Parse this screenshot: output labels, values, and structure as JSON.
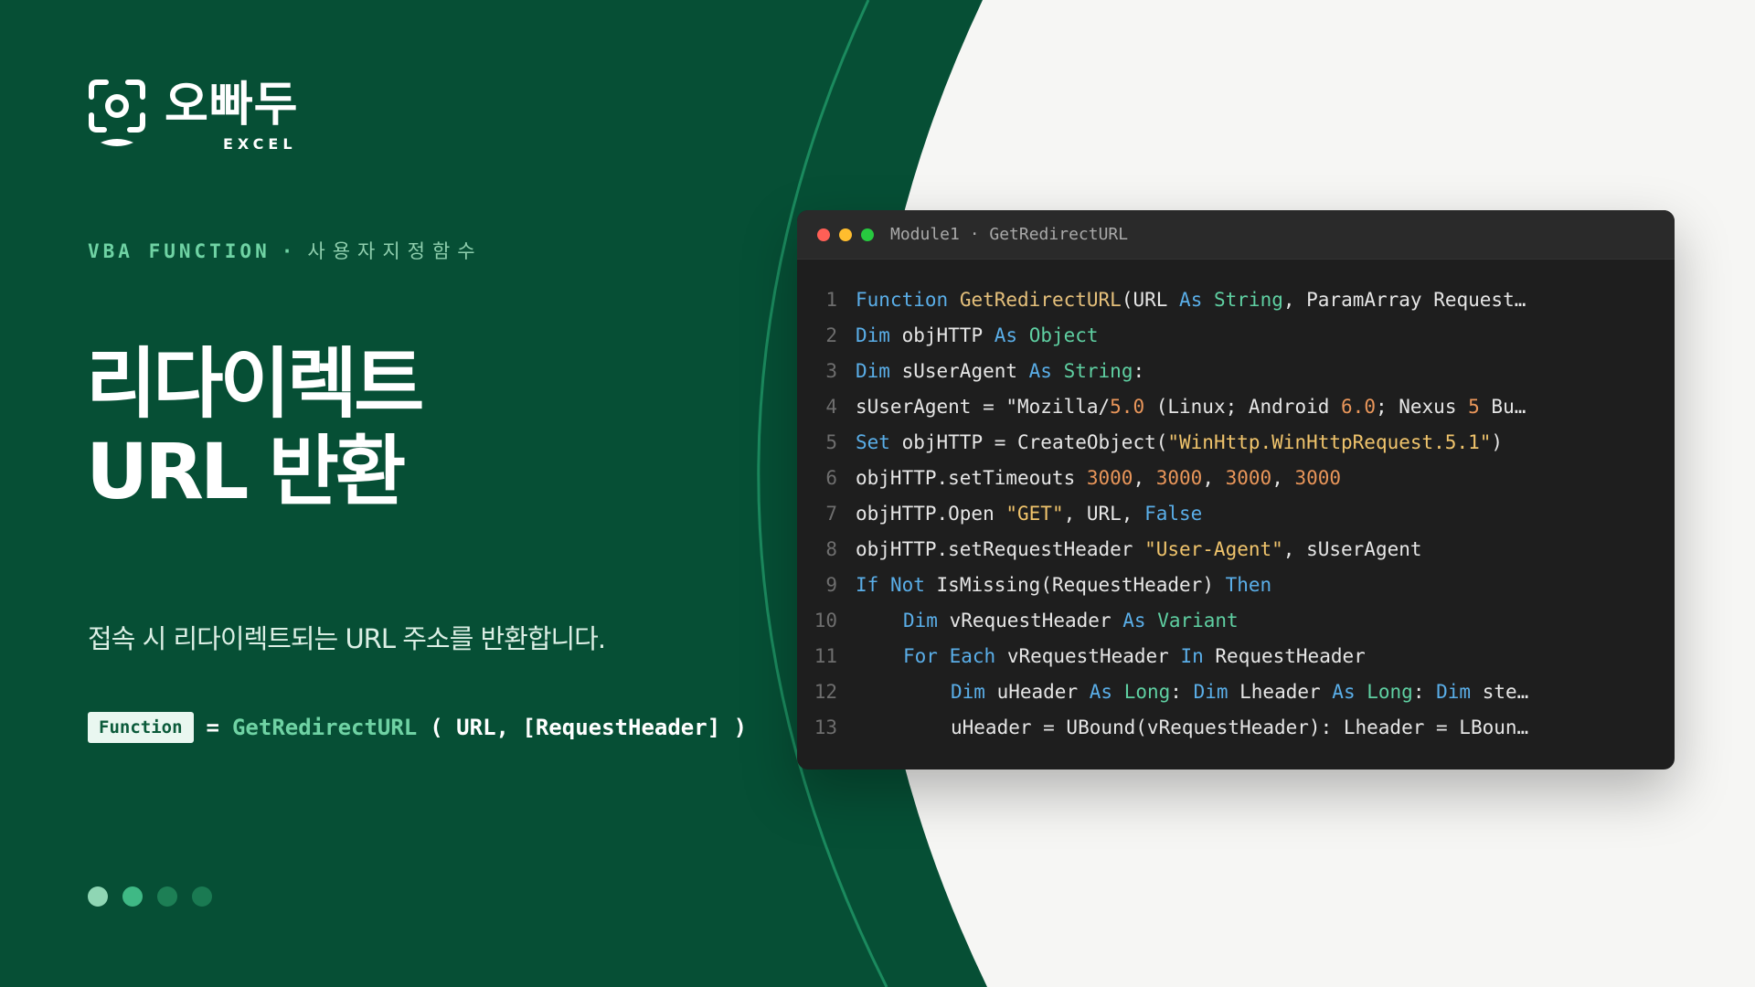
{
  "brand": {
    "name": "오빠두",
    "sub": "EXCEL"
  },
  "colors": {
    "primary": "#064f35",
    "accent": "#6fd3a4",
    "background": "#f6f6f4",
    "editor": "#1e1e1e"
  },
  "category": {
    "label": "VBA FUNCTION",
    "separator": "·",
    "korean": "사용자지정함수"
  },
  "title": {
    "line1": "리다이렉트",
    "line2": "URL 반환"
  },
  "description": "접속 시 리다이렉트되는 URL 주소를 반환합니다.",
  "syntax": {
    "badge": "Function",
    "equals": "=",
    "function_name": "GetRedirectURL",
    "args": "( URL, [RequestHeader] )"
  },
  "pagination": {
    "total": 4,
    "icon": "page-dot-icon"
  },
  "editor": {
    "title": "Module1 · GetRedirectURL",
    "window_controls": [
      "close-dot-icon",
      "minimize-dot-icon",
      "maximize-dot-icon"
    ],
    "lines": [
      {
        "n": "1",
        "tokens": [
          [
            "kw",
            "Function"
          ],
          [
            "p",
            " "
          ],
          [
            "fn",
            "GetRedirectURL"
          ],
          [
            "p",
            "(URL "
          ],
          [
            "kw",
            "As"
          ],
          [
            "p",
            " "
          ],
          [
            "ty",
            "String"
          ],
          [
            "p",
            ", ParamArray Request…"
          ]
        ]
      },
      {
        "n": "2",
        "tokens": [
          [
            "kw",
            "Dim"
          ],
          [
            "p",
            " objHTTP "
          ],
          [
            "kw",
            "As"
          ],
          [
            "p",
            " "
          ],
          [
            "ty",
            "Object"
          ]
        ]
      },
      {
        "n": "3",
        "tokens": [
          [
            "kw",
            "Dim"
          ],
          [
            "p",
            " sUserAgent "
          ],
          [
            "kw",
            "As"
          ],
          [
            "p",
            " "
          ],
          [
            "ty",
            "String"
          ],
          [
            "p",
            ":"
          ]
        ]
      },
      {
        "n": "4",
        "tokens": [
          [
            "p",
            "sUserAgent = \"Mozilla/"
          ],
          [
            "nm",
            "5.0"
          ],
          [
            "p",
            " (Linux; Android "
          ],
          [
            "nm",
            "6.0"
          ],
          [
            "p",
            "; Nexus "
          ],
          [
            "nm",
            "5"
          ],
          [
            "p",
            " Bu…"
          ]
        ]
      },
      {
        "n": "5",
        "tokens": [
          [
            "kw",
            "Set"
          ],
          [
            "p",
            " objHTTP = CreateObject("
          ],
          [
            "st",
            "\"WinHttp.WinHttpRequest.5.1\""
          ],
          [
            "p",
            ")"
          ]
        ]
      },
      {
        "n": "6",
        "tokens": [
          [
            "p",
            "objHTTP.setTimeouts "
          ],
          [
            "nm",
            "3000"
          ],
          [
            "p",
            ", "
          ],
          [
            "nm",
            "3000"
          ],
          [
            "p",
            ", "
          ],
          [
            "nm",
            "3000"
          ],
          [
            "p",
            ", "
          ],
          [
            "nm",
            "3000"
          ]
        ]
      },
      {
        "n": "7",
        "tokens": [
          [
            "p",
            "objHTTP.Open "
          ],
          [
            "st",
            "\"GET\""
          ],
          [
            "p",
            ", URL, "
          ],
          [
            "kw",
            "False"
          ]
        ]
      },
      {
        "n": "8",
        "tokens": [
          [
            "p",
            "objHTTP.setRequestHeader "
          ],
          [
            "st",
            "\"User-Agent\""
          ],
          [
            "p",
            ", sUserAgent"
          ]
        ]
      },
      {
        "n": "9",
        "tokens": [
          [
            "kw",
            "If"
          ],
          [
            "p",
            " "
          ],
          [
            "kw",
            "Not"
          ],
          [
            "p",
            " IsMissing(RequestHeader) "
          ],
          [
            "kw",
            "Then"
          ]
        ]
      },
      {
        "n": "10",
        "indent": 1,
        "tokens": [
          [
            "kw",
            "Dim"
          ],
          [
            "p",
            " vRequestHeader "
          ],
          [
            "kw",
            "As"
          ],
          [
            "p",
            " "
          ],
          [
            "ty",
            "Variant"
          ]
        ]
      },
      {
        "n": "11",
        "indent": 1,
        "tokens": [
          [
            "kw",
            "For"
          ],
          [
            "p",
            " "
          ],
          [
            "kw",
            "Each"
          ],
          [
            "p",
            " vRequestHeader "
          ],
          [
            "kw",
            "In"
          ],
          [
            "p",
            " RequestHeader"
          ]
        ]
      },
      {
        "n": "12",
        "indent": 2,
        "tokens": [
          [
            "kw",
            "Dim"
          ],
          [
            "p",
            " uHeader "
          ],
          [
            "kw",
            "As"
          ],
          [
            "p",
            " "
          ],
          [
            "ty",
            "Long"
          ],
          [
            "p",
            ": "
          ],
          [
            "kw",
            "Dim"
          ],
          [
            "p",
            " Lheader "
          ],
          [
            "kw",
            "As"
          ],
          [
            "p",
            " "
          ],
          [
            "ty",
            "Long"
          ],
          [
            "p",
            ": "
          ],
          [
            "kw",
            "Dim"
          ],
          [
            "p",
            " ste…"
          ]
        ]
      },
      {
        "n": "13",
        "indent": 2,
        "tokens": [
          [
            "p",
            "uHeader = UBound(vRequestHeader): Lheader = LBoun…"
          ]
        ]
      }
    ]
  }
}
